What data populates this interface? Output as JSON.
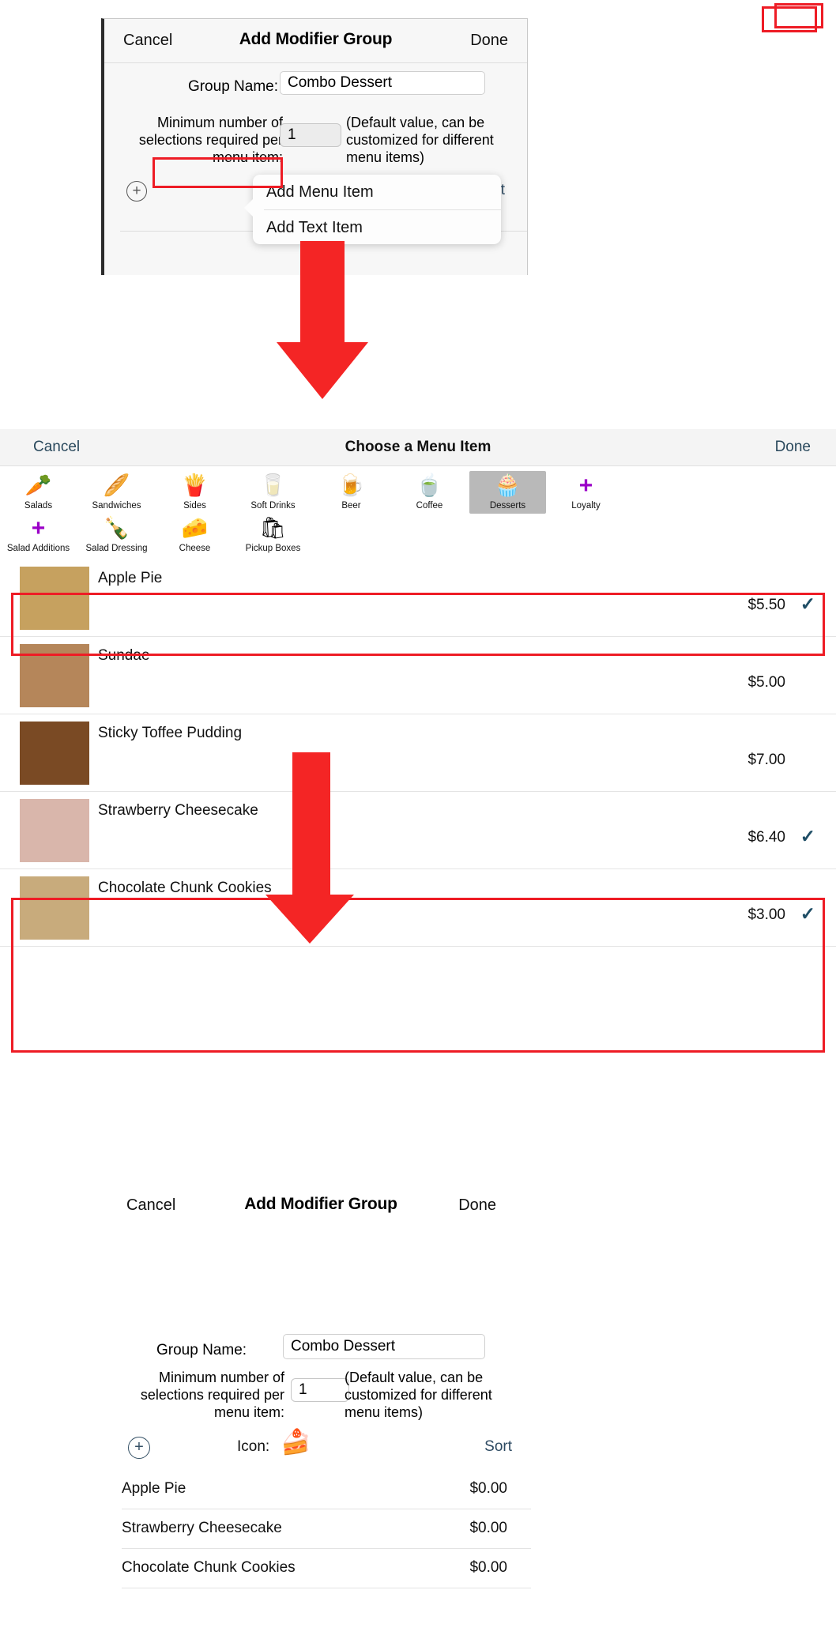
{
  "panel_top": {
    "nav": {
      "cancel": "Cancel",
      "title": "Add Modifier Group",
      "done": "Done"
    },
    "group_name_label": "Group Name:",
    "group_name_value": "Combo Dessert",
    "group_name_placeholder": "Group Name",
    "min_selections_label": "Minimum number of selections required per menu item:",
    "min_selections_value": "1",
    "default_note": "(Default value, can be customized for different menu items)",
    "sort_label": "Sort",
    "add_icon": "plus-circle-icon",
    "popover": {
      "items": [
        {
          "label": "Add Menu Item",
          "highlighted": true
        },
        {
          "label": "Add Text Item",
          "highlighted": false
        }
      ]
    }
  },
  "panel_middle": {
    "nav": {
      "cancel": "Cancel",
      "title": "Choose a Menu Item",
      "done": "Done",
      "done_highlighted": true
    },
    "categories": [
      {
        "label": "Salads",
        "icon": "carrot-icon",
        "emoji": "🥕",
        "selected": false
      },
      {
        "label": "Sandwiches",
        "icon": "bread-icon",
        "emoji": "🥖",
        "selected": false
      },
      {
        "label": "Sides",
        "icon": "fries-icon",
        "emoji": "🍟",
        "selected": false
      },
      {
        "label": "Soft Drinks",
        "icon": "milk-bottle-icon",
        "emoji": "🥛",
        "selected": false
      },
      {
        "label": "Beer",
        "icon": "beer-icon",
        "emoji": "🍺",
        "selected": false
      },
      {
        "label": "Coffee",
        "icon": "teacup-icon",
        "emoji": "🍵",
        "selected": false
      },
      {
        "label": "Desserts",
        "icon": "cupcake-icon",
        "emoji": "🧁",
        "selected": true
      },
      {
        "label": "Loyalty",
        "icon": "plus-icon",
        "emoji": "➕",
        "selected": false
      },
      {
        "label": "Salad Additions",
        "icon": "plus-icon",
        "emoji": "➕",
        "selected": false
      },
      {
        "label": "Salad Dressing",
        "icon": "bottle-icon",
        "emoji": "🍾",
        "selected": false
      },
      {
        "label": "Cheese",
        "icon": "cheese-icon",
        "emoji": "🧀",
        "selected": false
      },
      {
        "label": "Pickup  Boxes",
        "icon": "shopping-bag-icon",
        "emoji": "🛍",
        "selected": false
      }
    ],
    "items": [
      {
        "name": "Apple Pie",
        "price": "$5.50",
        "selected": true,
        "check": "✓",
        "thumb_color": "#c6a15f"
      },
      {
        "name": "Sundae",
        "price": "$5.00",
        "selected": false,
        "check": "✓",
        "thumb_color": "#b5865a"
      },
      {
        "name": "Sticky Toffee Pudding",
        "price": "$7.00",
        "selected": false,
        "check": "✓",
        "thumb_color": "#7a4a24"
      },
      {
        "name": "Strawberry Cheesecake",
        "price": "$6.40",
        "selected": true,
        "check": "✓",
        "thumb_color": "#d9b6ab"
      },
      {
        "name": "Chocolate Chunk Cookies",
        "price": "$3.00",
        "selected": true,
        "check": "✓",
        "thumb_color": "#c8ab7c"
      }
    ]
  },
  "panel_bottom": {
    "nav": {
      "cancel": "Cancel",
      "title": "Add Modifier Group",
      "done": "Done",
      "done_highlighted": true
    },
    "group_name_label": "Group Name:",
    "group_name_value": "Combo Dessert",
    "group_name_placeholder": "Group Name",
    "min_selections_label": "Minimum number of selections required per menu item:",
    "min_selections_value": "1",
    "default_note": "(Default value, can be customized for different menu items)",
    "icon_label": "Icon:",
    "icon_emoji": "🍰",
    "icon_name": "cake-slice-icon",
    "sort_label": "Sort",
    "add_icon": "plus-circle-icon",
    "rows": [
      {
        "name": "Apple Pie",
        "price": "$0.00"
      },
      {
        "name": "Strawberry Cheesecake",
        "price": "$0.00"
      },
      {
        "name": "Chocolate Chunk Cookies",
        "price": "$0.00"
      }
    ]
  },
  "annotations": {
    "highlight_color": "#ee1c25",
    "arrow_color": "#f42525"
  }
}
